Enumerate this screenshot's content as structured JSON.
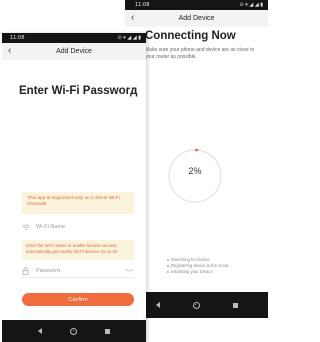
{
  "back_screen": {
    "status": {
      "time": "11:08",
      "icons_text": "⊙ ▾ ◢ ◢ ▮"
    },
    "title": "Add Device",
    "back_glyph": "‹",
    "heading": "Connecting Now",
    "subtitle": "Make sure your phone and device are as close to your router as possible.",
    "progress": {
      "percent_label": "2%",
      "value": 0.02,
      "track_color": "#e2e2e2",
      "fill_color": "#f06b3d"
    },
    "steps": [
      "Searching for Device",
      "Registering device to the cloud",
      "Initializing your Device"
    ]
  },
  "front_screen": {
    "status": {
      "time": "11:08",
      "icons_text": "⊙ ▾ ◢ ◢ ▮"
    },
    "title": "Add Device",
    "back_glyph": "‹",
    "heading": "Enter Wi-Fi Passworд",
    "note": "This app is supported only on 2.4GHz Wi-Fi channels",
    "wifi_placeholder": "Wi-Fi Name",
    "warning": "Enter the Wi-Fi name or enable location access, automatically get nearby Wi-Fi devices Go to Se",
    "password_placeholder": "Password",
    "confirm_label": "Confirm"
  },
  "colors": {
    "accent": "#f06b3d",
    "note_bg": "#fbf4dd",
    "note_text": "#e0633e"
  }
}
